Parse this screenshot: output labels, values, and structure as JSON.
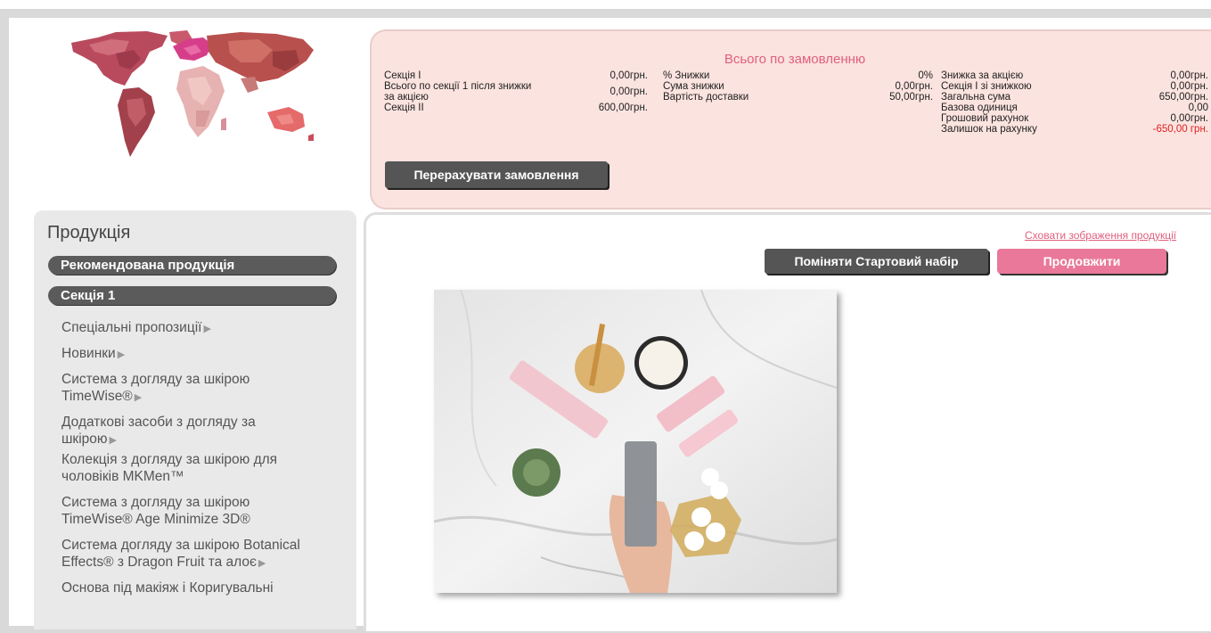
{
  "summary": {
    "title": "Всього по замовленню",
    "col1": [
      {
        "label": "Секція I",
        "value": "0,00грн."
      },
      {
        "label": "Всього по секції 1 після знижки за акцією",
        "value": "0,00грн."
      },
      {
        "label": "Секція II",
        "value": "600,00грн."
      }
    ],
    "col2": [
      {
        "label": "% Знижки",
        "value": "0%"
      },
      {
        "label": "Сума знижки",
        "value": "0,00грн."
      },
      {
        "label": "Вартість доставки",
        "value": "50,00грн."
      }
    ],
    "col3": [
      {
        "label": "Знижка за акцією",
        "value": "0,00грн."
      },
      {
        "label": "Секція I зі знижкою",
        "value": "0,00грн."
      },
      {
        "label": "Загальна сума",
        "value": "650,00грн."
      },
      {
        "label": "Базова одиниця",
        "value": "0,00"
      },
      {
        "label": "Грошовий рахунок",
        "value": "0,00грн."
      },
      {
        "label": "Залишок на рахунку",
        "value": "-650,00 грн."
      }
    ],
    "recalc_label": "Перерахувати замовлення"
  },
  "sidebar": {
    "heading": "Продукція",
    "pill_recommended": "Рекомендована продукція",
    "pill_section1": "Секція 1",
    "items": [
      {
        "label": "Спеціальні пропозиції",
        "arrow": "▶"
      },
      {
        "label": "Новинки",
        "arrow": "▶"
      },
      {
        "label": "Система з догляду за шкірою TimeWise®",
        "arrow": "▶"
      },
      {
        "label": "Додаткові засоби з догляду за шкірою",
        "arrow": "▶"
      },
      {
        "label": "Колекція з догляду за шкірою для чоловіків MKMen™",
        "arrow": ""
      },
      {
        "label": "Система з догляду за шкірою TimeWise® Age Minimize 3D®",
        "arrow": ""
      },
      {
        "label": "Система догляду за шкірою Botanical Effects® з Dragon Fruit та алоє",
        "arrow": "▶"
      },
      {
        "label": "Основа під макіяж і Коригувальні",
        "arrow": ""
      }
    ]
  },
  "content": {
    "hide_images_link": "Сховати зображення продукції",
    "swap_button": "Поміняти Стартовий набір",
    "continue_button": "Продовжити"
  },
  "colors": {
    "accent_pink": "#e9789a",
    "summary_bg": "#fbe3df",
    "dark_button": "#555555",
    "negative": "#e02020"
  }
}
